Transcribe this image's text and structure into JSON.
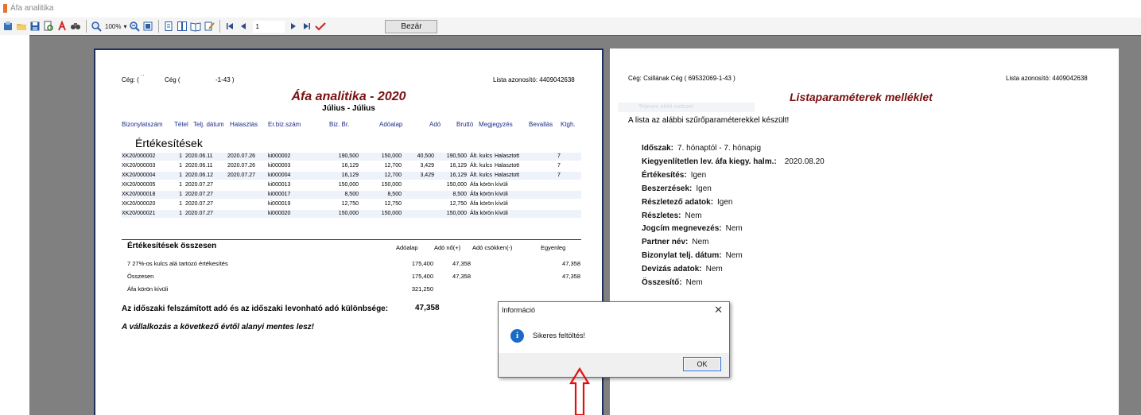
{
  "window": {
    "title": "Áfa analitika"
  },
  "toolbar": {
    "zoom": "100%",
    "page_number": "1",
    "close_label": "Bezár"
  },
  "page1": {
    "company_label": "Cég: (",
    "company_mid": "Cég (",
    "company_code": "-1-43 )",
    "list_id": "Lista azonosító: 4409042638",
    "title": "Áfa analitika - 2020",
    "subtitle": "Július - Július",
    "columns": [
      "Bizonylatszám",
      "Tétel",
      "Telj. dátum",
      "Halasztás",
      "Er.biz.szám",
      "Biz. Br.",
      "Adóalap",
      "Adó",
      "Bruttó",
      "Megjegyzés",
      "Bevallás",
      "Ktgh."
    ],
    "section_title": "Értékesítések",
    "rows": [
      {
        "doc": "XK20/000002",
        "item": "1",
        "date": "2020.06.11",
        "defer": "2020.07.26",
        "orig": "ki000002",
        "gross_doc": "190,500",
        "base": "150,000",
        "tax": "40,500",
        "gross": "190,500",
        "note": "Ált. kulcs",
        "note2": "Halasztott",
        "decl": "7"
      },
      {
        "doc": "XK20/000003",
        "item": "1",
        "date": "2020.06.11",
        "defer": "2020.07.26",
        "orig": "ki000003",
        "gross_doc": "16,129",
        "base": "12,700",
        "tax": "3,429",
        "gross": "16,129",
        "note": "Ált. kulcs",
        "note2": "Halasztott",
        "decl": "7"
      },
      {
        "doc": "XK20/000004",
        "item": "1",
        "date": "2020.06.12",
        "defer": "2020.07.27",
        "orig": "ki000004",
        "gross_doc": "16,129",
        "base": "12,700",
        "tax": "3,429",
        "gross": "16,129",
        "note": "Ált. kulcs",
        "note2": "Halasztott",
        "decl": "7"
      },
      {
        "doc": "XK20/000005",
        "item": "1",
        "date": "2020.07.27",
        "defer": "",
        "orig": "ki000013",
        "gross_doc": "150,000",
        "base": "150,000",
        "tax": "",
        "gross": "150,000",
        "note": "Áfa körön kívüli",
        "note2": "",
        "decl": ""
      },
      {
        "doc": "XK20/000018",
        "item": "1",
        "date": "2020.07.27",
        "defer": "",
        "orig": "ki000017",
        "gross_doc": "8,500",
        "base": "8,500",
        "tax": "",
        "gross": "8,500",
        "note": "Áfa körön kívüli",
        "note2": "",
        "decl": ""
      },
      {
        "doc": "XK20/000020",
        "item": "1",
        "date": "2020.07.27",
        "defer": "",
        "orig": "ki000019",
        "gross_doc": "12,750",
        "base": "12,750",
        "tax": "",
        "gross": "12,750",
        "note": "Áfa körön kívüli",
        "note2": "",
        "decl": ""
      },
      {
        "doc": "XK20/000021",
        "item": "1",
        "date": "2020.07.27",
        "defer": "",
        "orig": "ki000020",
        "gross_doc": "150,000",
        "base": "150,000",
        "tax": "",
        "gross": "150,000",
        "note": "Áfa körön kívüli",
        "note2": "",
        "decl": ""
      }
    ],
    "summary": {
      "title": "Értékesítések összesen",
      "col_base": "Adóalap",
      "col_plus": "Adó nő(+)",
      "col_minus": "Adó csökken(-)",
      "col_balance": "Egyenleg",
      "lines": [
        {
          "label": "7 27%-os kulcs alá tartozó értékesítés",
          "base": "175,400",
          "plus": "47,358",
          "balance": "47,358"
        },
        {
          "label": "Összesen",
          "base": "175,400",
          "plus": "47,358",
          "balance": "47,358"
        },
        {
          "label": "Áfa körön kívüli",
          "base": "321,250",
          "plus": "",
          "balance": ""
        }
      ]
    },
    "difference_label": "Az időszaki felszámított adó és az időszaki levonható adó különbsége:",
    "difference_value": "47,358",
    "exempt_note": "A vállalkozás a következő évtől alanyi mentes lesz!"
  },
  "page2": {
    "company": "Cég: Csillának Cég ( 69532069-1-43 )",
    "list_id": "Lista azonosító: 4409042638",
    "title": "Listaparaméterek melléklet",
    "ghost_text": "Teljesen elelő metszet",
    "intro": "A lista az alábbi szűrőparaméterekkel készült!",
    "params": [
      {
        "label": "Időszak:",
        "value": "7. hónaptól - 7. hónapig"
      },
      {
        "label": "Kiegyenlítetlen lev. áfa kiegy. halm.:",
        "value": "2020.08.20"
      },
      {
        "label": "Értékesítés:",
        "value": "Igen"
      },
      {
        "label": "Beszerzések:",
        "value": "Igen"
      },
      {
        "label": "Részletező adatok:",
        "value": "Igen"
      },
      {
        "label": "Részletes:",
        "value": "Nem"
      },
      {
        "label": "Jogcím megnevezés:",
        "value": "Nem"
      },
      {
        "label": "Partner név:",
        "value": "Nem"
      },
      {
        "label": "Bizonylat telj. dátum:",
        "value": "Nem"
      },
      {
        "label": "Devizás adatok:",
        "value": "Nem"
      },
      {
        "label": "Összesítő:",
        "value": "Nem"
      }
    ]
  },
  "dialog": {
    "title": "Információ",
    "message": "Sikeres feltöltés!",
    "ok_label": "OK",
    "close_glyph": "✕",
    "icon_glyph": "i"
  },
  "colors": {
    "viewer_bg": "#808080",
    "title_red": "#7a1010",
    "header_blue": "#1f2d8a",
    "arrow_red": "#e01010"
  }
}
